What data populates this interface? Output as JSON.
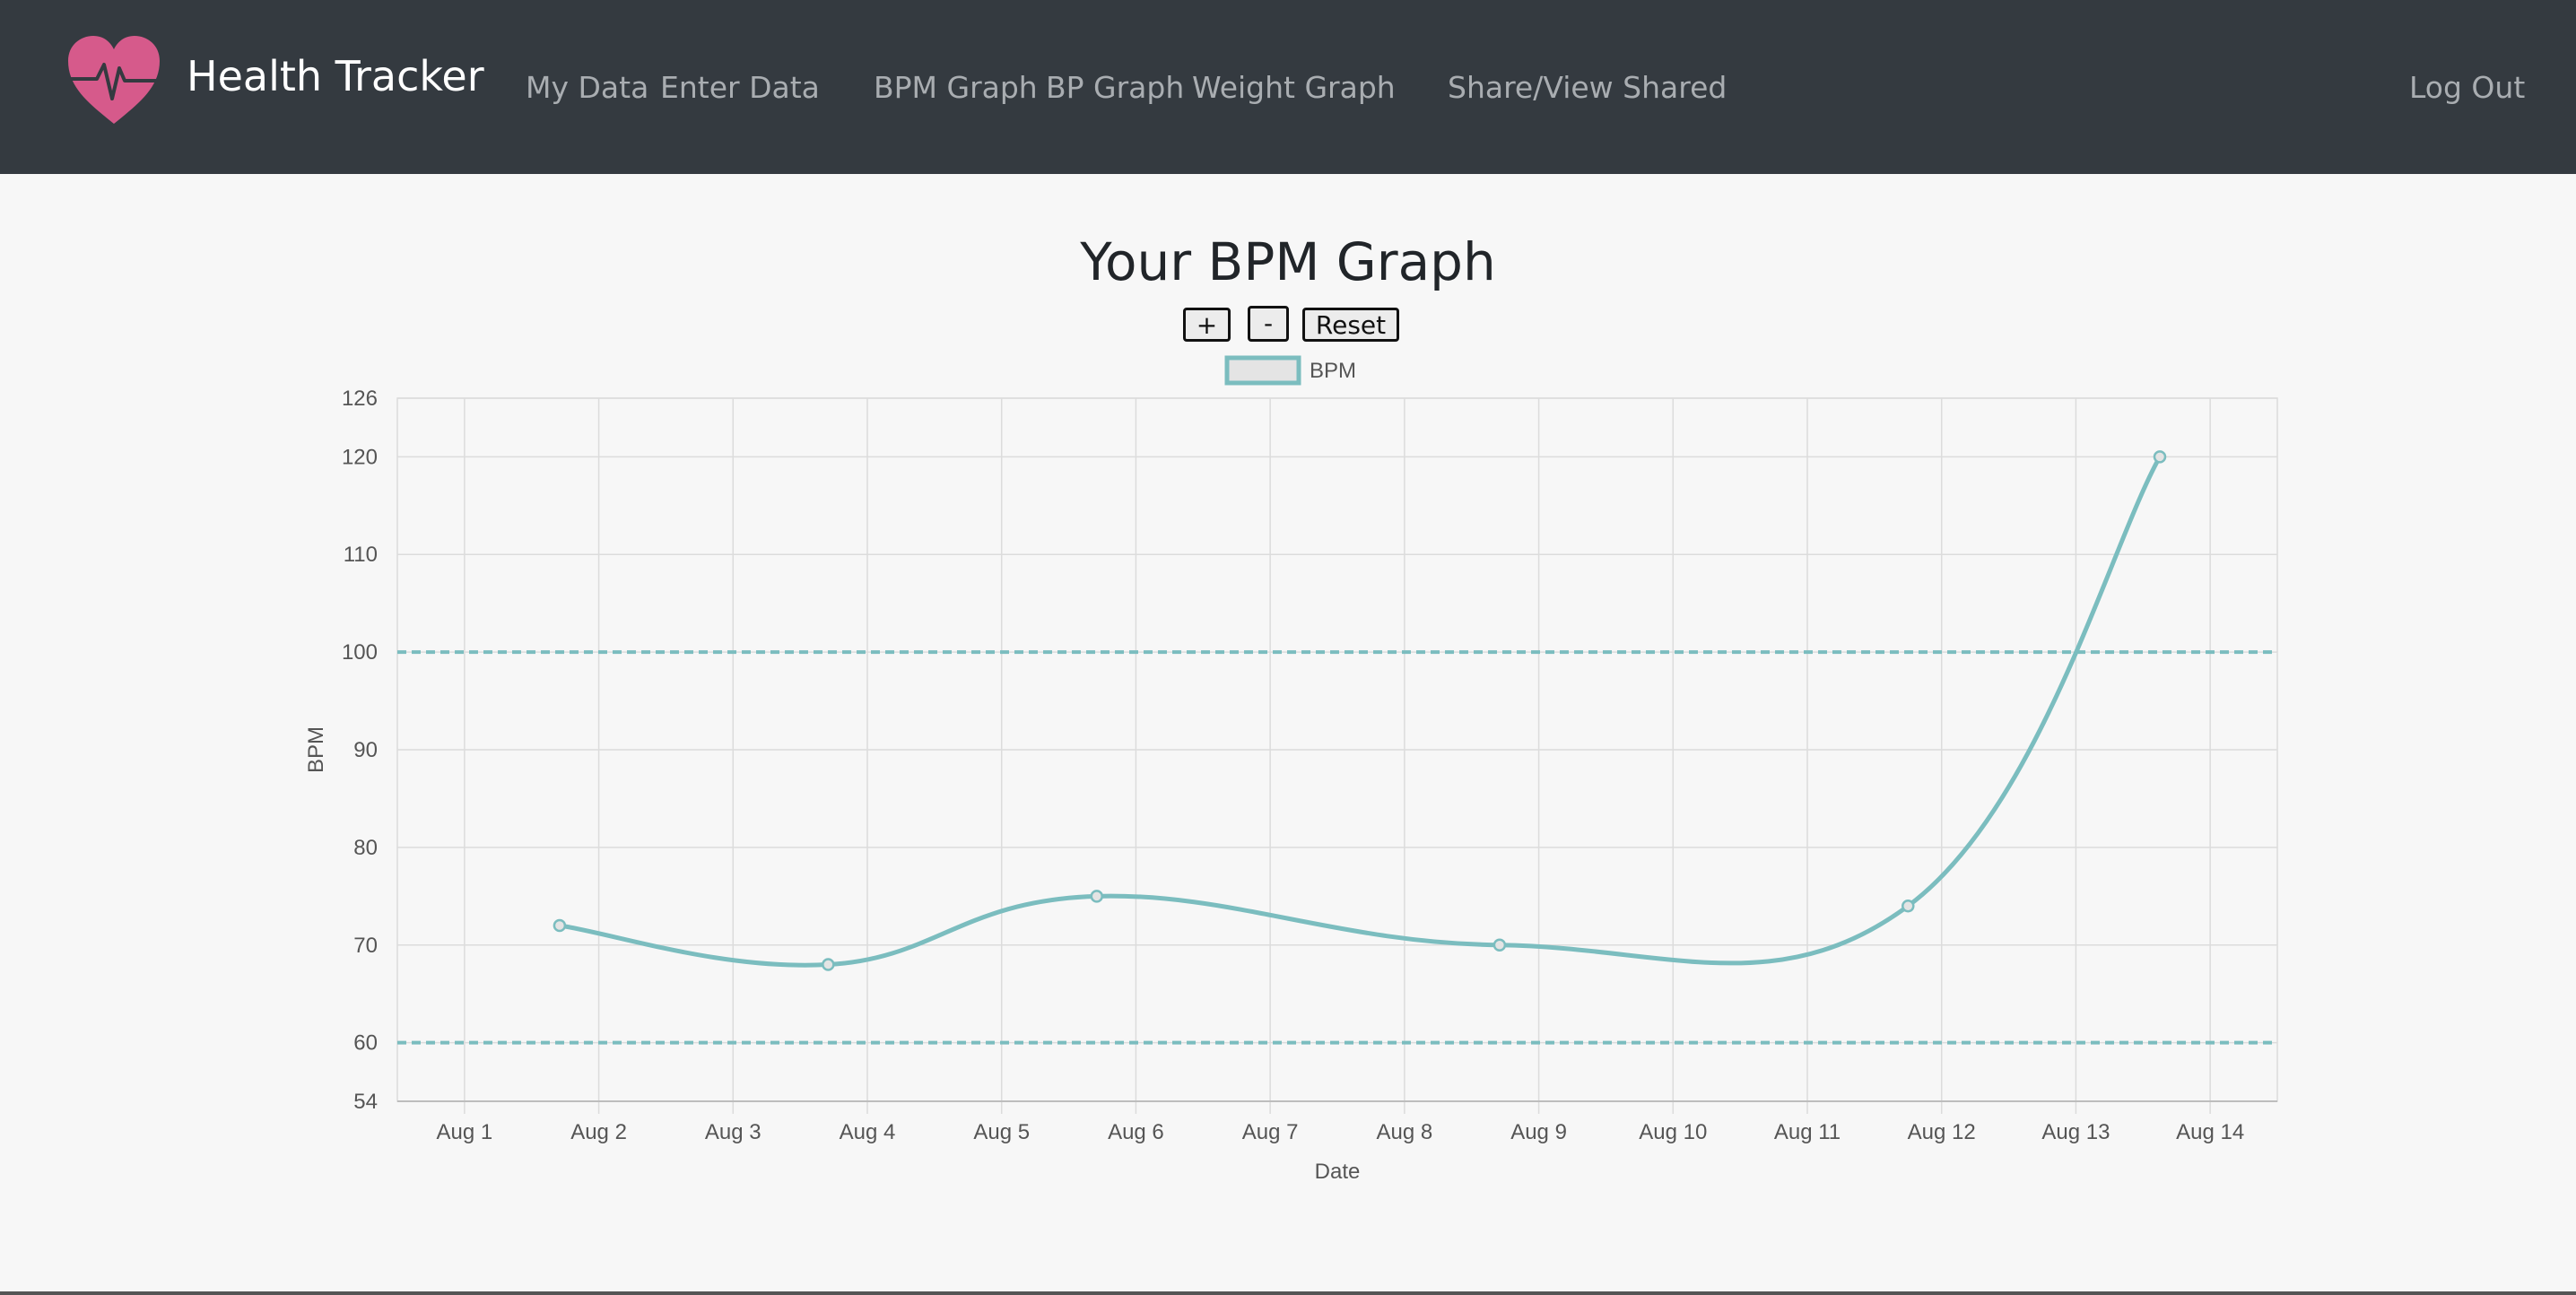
{
  "app": {
    "title": "Health Tracker"
  },
  "nav": {
    "my_data": "My Data",
    "enter_data": "Enter Data",
    "bpm_graph": "BPM Graph",
    "bp_graph": "BP Graph",
    "weight_graph": "Weight Graph",
    "share": "Share/View Shared",
    "logout": "Log Out"
  },
  "page": {
    "title": "Your BPM Graph"
  },
  "controls": {
    "zoom_in": "+",
    "zoom_out": "-",
    "reset": "Reset"
  },
  "colors": {
    "navbar": "#343a40",
    "logo": "#d65a8b",
    "series": "#7bbdbf"
  },
  "chart_data": {
    "type": "line",
    "xlabel": "Date",
    "ylabel": "BPM",
    "x_ticks": [
      "Aug 1",
      "Aug 2",
      "Aug 3",
      "Aug 4",
      "Aug 5",
      "Aug 6",
      "Aug 7",
      "Aug 8",
      "Aug 9",
      "Aug 10",
      "Aug 11",
      "Aug 12",
      "Aug 13",
      "Aug 14"
    ],
    "y_ticks": [
      54,
      60,
      70,
      80,
      90,
      100,
      110,
      120,
      126
    ],
    "ylim": [
      54,
      126
    ],
    "xlim": [
      "2023-07-31T12:00",
      "2023-08-14T12:00"
    ],
    "grid": true,
    "legend": "top-center",
    "series": [
      {
        "name": "BPM",
        "points": [
          {
            "x": "2023-08-01T17:00",
            "y": 72
          },
          {
            "x": "2023-08-03T17:00",
            "y": 68
          },
          {
            "x": "2023-08-05T17:00",
            "y": 75
          },
          {
            "x": "2023-08-08T17:00",
            "y": 70
          },
          {
            "x": "2023-08-11T18:00",
            "y": 74
          },
          {
            "x": "2023-08-13T15:00",
            "y": 120
          }
        ]
      }
    ],
    "reference_lines": [
      100,
      60
    ]
  }
}
